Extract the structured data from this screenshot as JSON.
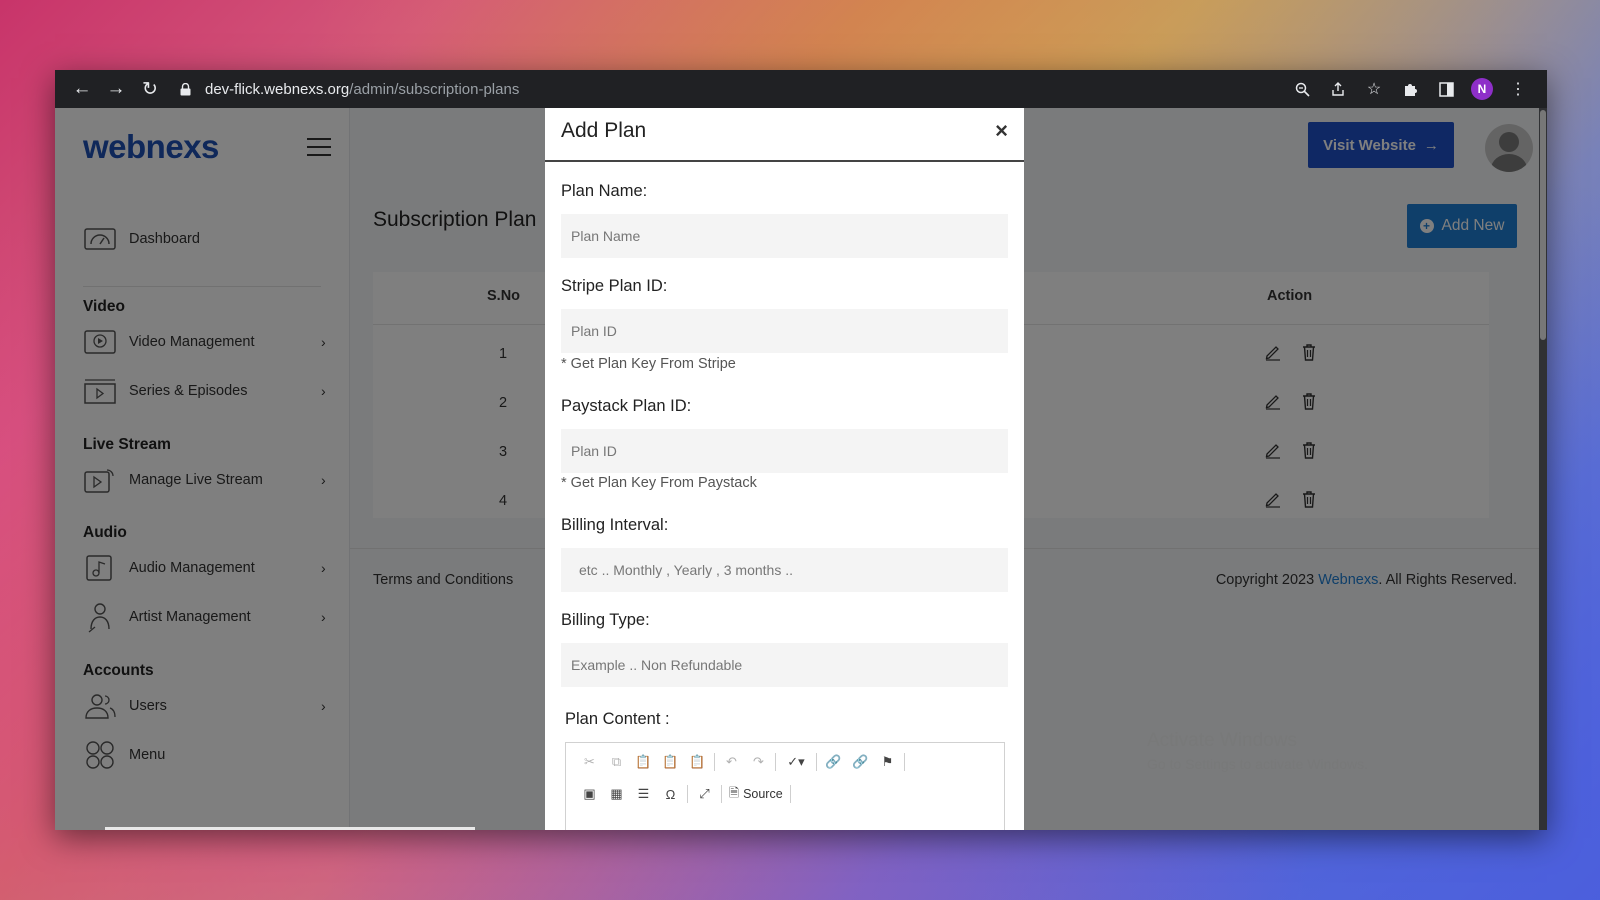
{
  "browser": {
    "url_host": "dev-flick.webnexs.org",
    "url_path": "/admin/subscription-plans",
    "profile_initial": "N"
  },
  "sidebar": {
    "logo": "webnexs",
    "items": [
      {
        "label": "Dashboard",
        "icon": "dashboard-icon"
      },
      {
        "label": "Video Management",
        "icon": "video-icon"
      },
      {
        "label": "Series & Episodes",
        "icon": "series-icon"
      },
      {
        "label": "Manage Live Stream",
        "icon": "live-stream-icon"
      },
      {
        "label": "Audio Management",
        "icon": "audio-icon"
      },
      {
        "label": "Artist Management",
        "icon": "artist-icon"
      },
      {
        "label": "Users",
        "icon": "users-icon"
      },
      {
        "label": "Menu",
        "icon": "menu-grid-icon"
      }
    ],
    "sections": [
      "Video",
      "Live Stream",
      "Audio",
      "Accounts"
    ]
  },
  "header": {
    "visit_label": "Visit Website"
  },
  "main": {
    "title": "Subscription Plan",
    "add_new_label": "Add New",
    "table": {
      "headers": [
        "S.No",
        "Action"
      ],
      "rows": [
        "1",
        "2",
        "3",
        "4"
      ]
    }
  },
  "footer": {
    "left": "Terms and Conditions",
    "copyright_prefix": "Copyright 2023 ",
    "copyright_link": "Webnexs",
    "copyright_suffix": ". All Rights Reserved."
  },
  "watermark": {
    "title": "Activate Windows",
    "subtitle": "Go to Settings to activate Windows."
  },
  "modal": {
    "title": "Add Plan",
    "close": "×",
    "plan_name_label": "Plan Name:",
    "plan_name_placeholder": "Plan Name",
    "stripe_label": "Stripe Plan ID:",
    "stripe_placeholder": "Plan ID",
    "stripe_hint": "* Get Plan Key From Stripe",
    "paystack_label": "Paystack Plan ID:",
    "paystack_placeholder": "Plan ID",
    "paystack_hint": "* Get Plan Key From Paystack",
    "interval_label": "Billing Interval:",
    "interval_placeholder": "etc .. Monthly , Yearly , 3 months ..",
    "type_label": "Billing Type:",
    "type_placeholder": "Example .. Non Refundable",
    "content_label": "Plan Content :",
    "editor_source_label": "Source"
  }
}
